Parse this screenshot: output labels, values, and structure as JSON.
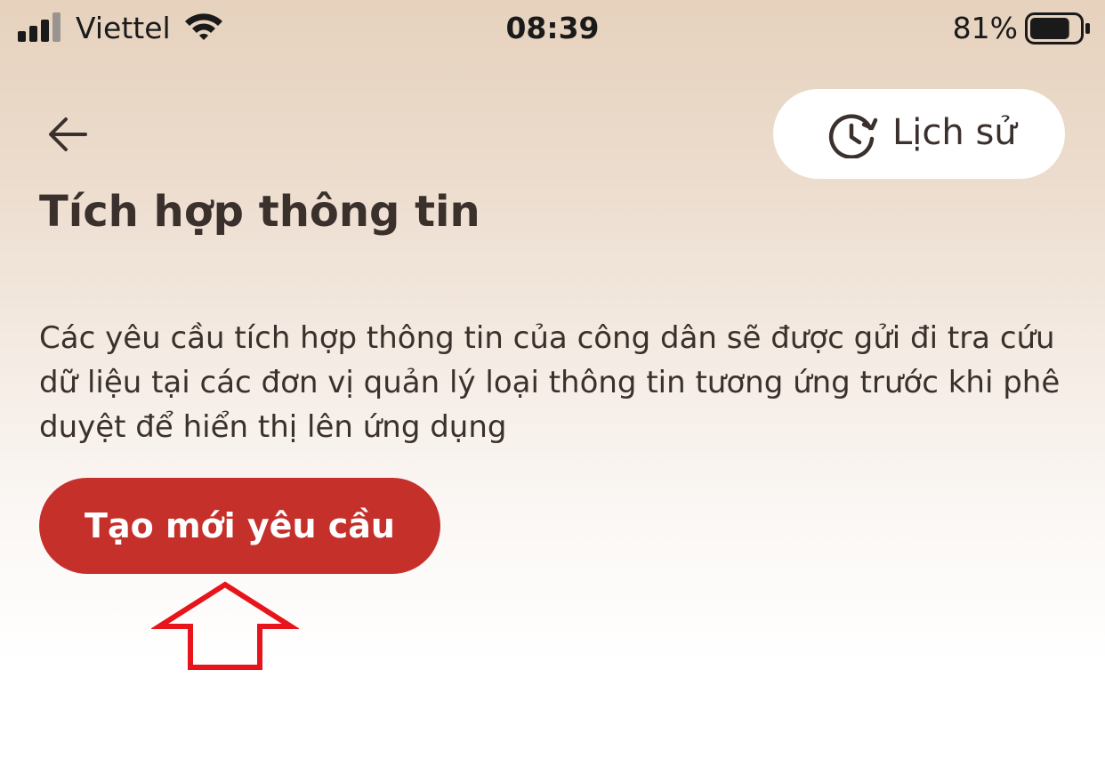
{
  "status_bar": {
    "carrier": "Viettel",
    "time": "08:39",
    "battery_percent": "81%",
    "battery_level": 0.81,
    "icons": [
      "signal-icon",
      "wifi-icon",
      "battery-icon"
    ]
  },
  "header": {
    "back_icon": "arrow-left-icon",
    "history_label": "Lịch sử",
    "history_icon": "clock-history-icon"
  },
  "main": {
    "title": "Tích hợp thông tin",
    "description": "Các yêu cầu tích hợp thông tin của công dân sẽ được gửi đi tra cứu dữ liệu tại các đơn vị quản lý loại thông tin tương ứng trước khi phê duyệt để hiển thị lên ứng dụng",
    "create_button_label": "Tạo mới yêu cầu"
  },
  "annotation": {
    "icon": "up-arrow-annotation-icon",
    "color": "#e8141b"
  },
  "colors": {
    "accent": "#c5302b",
    "text": "#3a302c",
    "background_top": "#e6d2bd",
    "background_bottom": "#ffffff"
  }
}
